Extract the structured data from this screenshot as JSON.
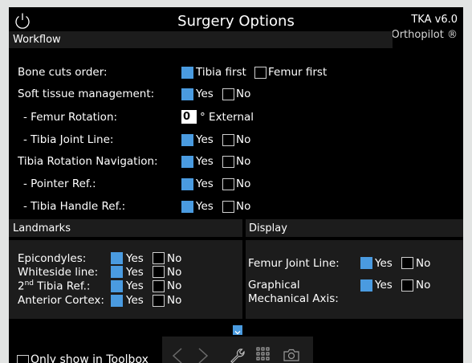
{
  "header": {
    "title": "Surgery Options",
    "version": "TKA v6.0",
    "product": "Orthopilot ®"
  },
  "workflow": {
    "section_label": "Workflow",
    "bone_cuts": {
      "label": "Bone cuts order:",
      "opt1": "Tibia first",
      "opt2": "Femur first"
    },
    "soft_tissue": {
      "label": "Soft tissue management:",
      "yes": "Yes",
      "no": "No"
    },
    "femur_rotation": {
      "label": "- Femur Rotation:",
      "value": "0",
      "unit": "° External"
    },
    "tibia_joint_line": {
      "label": "- Tibia Joint Line:",
      "yes": "Yes",
      "no": "No"
    },
    "tibia_rotation_nav": {
      "label": "Tibia Rotation Navigation:",
      "yes": "Yes",
      "no": "No"
    },
    "pointer_ref": {
      "label": "- Pointer Ref.:",
      "yes": "Yes",
      "no": "No"
    },
    "tibia_handle_ref": {
      "label": "- Tibia Handle Ref.:",
      "yes": "Yes",
      "no": "No"
    }
  },
  "landmarks": {
    "section_label": "Landmarks",
    "epicondyles": {
      "label": "Epicondyles:",
      "yes": "Yes",
      "no": "No"
    },
    "whiteside": {
      "label": "Whiteside line:",
      "yes": "Yes",
      "no": "No"
    },
    "tibia_ref2": {
      "label_pre": "2",
      "label_sup": "nd",
      "label_post": " Tibia Ref.:",
      "yes": "Yes",
      "no": "No"
    },
    "anterior_cortex": {
      "label": "Anterior Cortex:",
      "yes": "Yes",
      "no": "No"
    }
  },
  "display": {
    "section_label": "Display",
    "femur_joint_line": {
      "label": "Femur Joint Line:",
      "yes": "Yes",
      "no": "No"
    },
    "graphical_axis": {
      "label1": "Graphical",
      "label2": "Mechanical Axis:",
      "yes": "Yes",
      "no": "No"
    }
  },
  "footer": {
    "only_show_toolbox": "Only show in Toolbox"
  },
  "colors": {
    "accent": "#4a9be0",
    "panel": "#1c1c1c",
    "background": "#000000"
  },
  "icons": [
    "power-icon",
    "back-arrow-icon",
    "forward-arrow-icon",
    "wrench-icon",
    "grid-icon",
    "camera-icon",
    "chevron-down-icon"
  ]
}
